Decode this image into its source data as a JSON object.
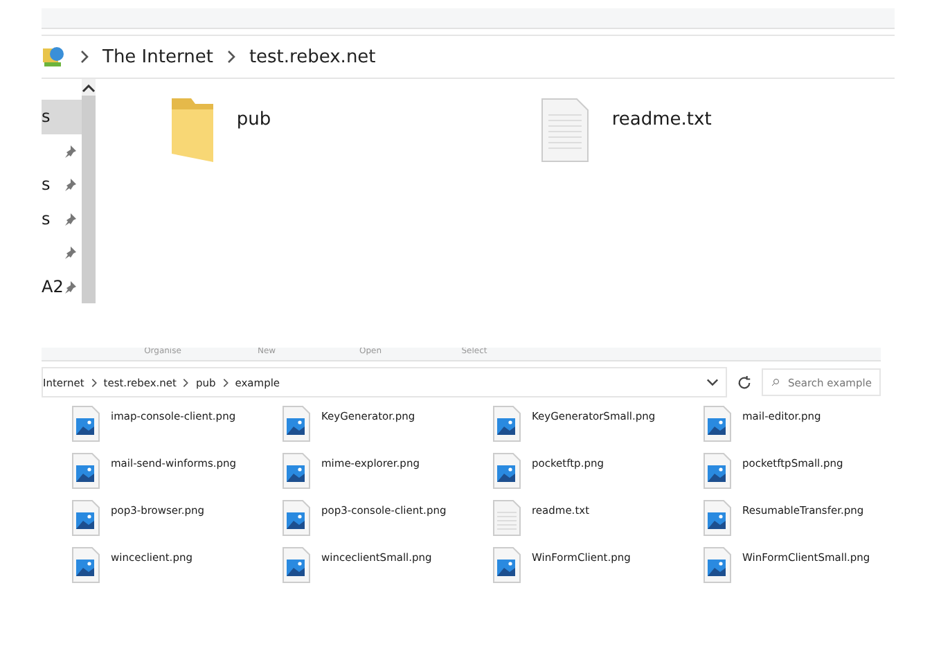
{
  "top_window": {
    "breadcrumb": [
      "The Internet",
      "test.rebex.net"
    ],
    "sidebar": {
      "items": [
        {
          "label": "s",
          "selected": true,
          "pinned": false
        },
        {
          "selected": false,
          "pinned": true
        },
        {
          "label": "s",
          "selected": false,
          "pinned": true
        },
        {
          "label": "s",
          "selected": false,
          "pinned": true
        },
        {
          "selected": false,
          "pinned": true
        },
        {
          "label": "A2",
          "selected": false,
          "pinned": true
        }
      ]
    },
    "files": [
      {
        "name": "pub",
        "kind": "folder"
      },
      {
        "name": "readme.txt",
        "kind": "text"
      }
    ]
  },
  "bottom_window": {
    "ribbon_groups": [
      "Organise",
      "New",
      "Open",
      "Select"
    ],
    "breadcrumb": [
      "Internet",
      "test.rebex.net",
      "pub",
      "example"
    ],
    "search": {
      "placeholder": "Search example"
    },
    "files": [
      {
        "name": "imap-console-client.png",
        "kind": "image"
      },
      {
        "name": "KeyGenerator.png",
        "kind": "image"
      },
      {
        "name": "KeyGeneratorSmall.png",
        "kind": "image"
      },
      {
        "name": "mail-editor.png",
        "kind": "image"
      },
      {
        "name": "mail-send-winforms.png",
        "kind": "image"
      },
      {
        "name": "mime-explorer.png",
        "kind": "image"
      },
      {
        "name": "pocketftp.png",
        "kind": "image"
      },
      {
        "name": "pocketftpSmall.png",
        "kind": "image"
      },
      {
        "name": "pop3-browser.png",
        "kind": "image"
      },
      {
        "name": "pop3-console-client.png",
        "kind": "image"
      },
      {
        "name": "readme.txt",
        "kind": "text"
      },
      {
        "name": "ResumableTransfer.png",
        "kind": "image"
      },
      {
        "name": "winceclient.png",
        "kind": "image"
      },
      {
        "name": "winceclientSmall.png",
        "kind": "image"
      },
      {
        "name": "WinFormClient.png",
        "kind": "image"
      },
      {
        "name": "WinFormClientSmall.png",
        "kind": "image"
      }
    ]
  }
}
